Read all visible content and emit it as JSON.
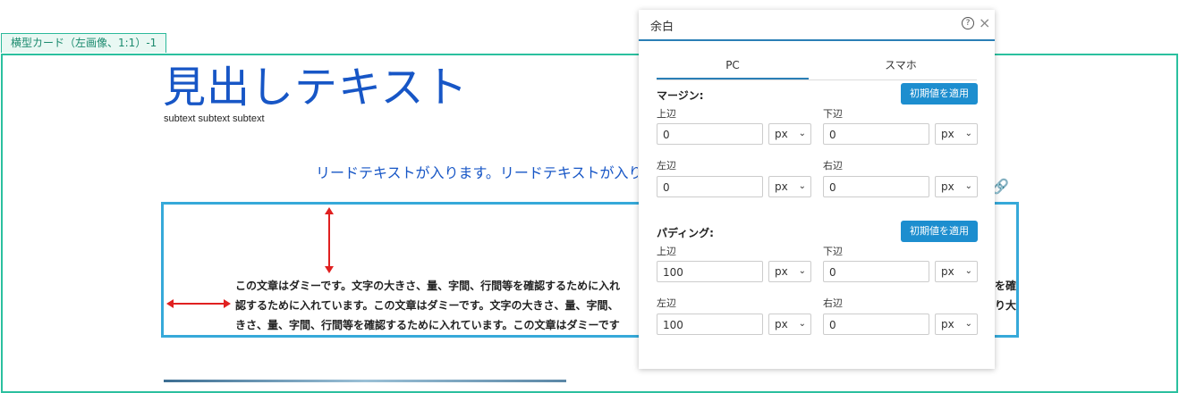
{
  "canvas": {
    "card_tab_label": "横型カード（左画像、1:1）-1",
    "heading": "見出しテキスト",
    "subtext": "subtext subtext subtext",
    "lead": "リードテキストが入ります。リードテキストが入り",
    "body_lines": [
      "この文章はダミーです。文字の大きさ、量、字間、行間等を確認するために入れ",
      "認するために入れています。この文章はダミーです。文字の大きさ、量、字間、",
      "きさ、量、字間、行間等を確認するために入れています。この文章はダミーです"
    ],
    "body_lines_right": [
      "を確",
      "り大",
      ""
    ]
  },
  "panel": {
    "title": "余白",
    "help_symbol": "?",
    "close_symbol": "×",
    "tabs": [
      {
        "label": "PC",
        "active": true
      },
      {
        "label": "スマホ",
        "active": false
      }
    ],
    "margin": {
      "label": "マージン:",
      "apply_label": "初期値を適用",
      "top": {
        "label": "上辺",
        "value": "0",
        "unit": "px"
      },
      "bottom": {
        "label": "下辺",
        "value": "0",
        "unit": "px"
      },
      "left": {
        "label": "左辺",
        "value": "0",
        "unit": "px"
      },
      "right": {
        "label": "右辺",
        "value": "0",
        "unit": "px"
      }
    },
    "padding": {
      "label": "パディング:",
      "apply_label": "初期値を適用",
      "top": {
        "label": "上辺",
        "value": "100",
        "unit": "px"
      },
      "bottom": {
        "label": "下辺",
        "value": "0",
        "unit": "px"
      },
      "left": {
        "label": "左辺",
        "value": "100",
        "unit": "px"
      },
      "right": {
        "label": "右辺",
        "value": "0",
        "unit": "px"
      }
    }
  },
  "colors": {
    "card_frame": "#2bc09f",
    "block_frame": "#36a9d9",
    "heading": "#1756c6",
    "accent": "#1d8ecf",
    "arrow": "#e02020"
  }
}
